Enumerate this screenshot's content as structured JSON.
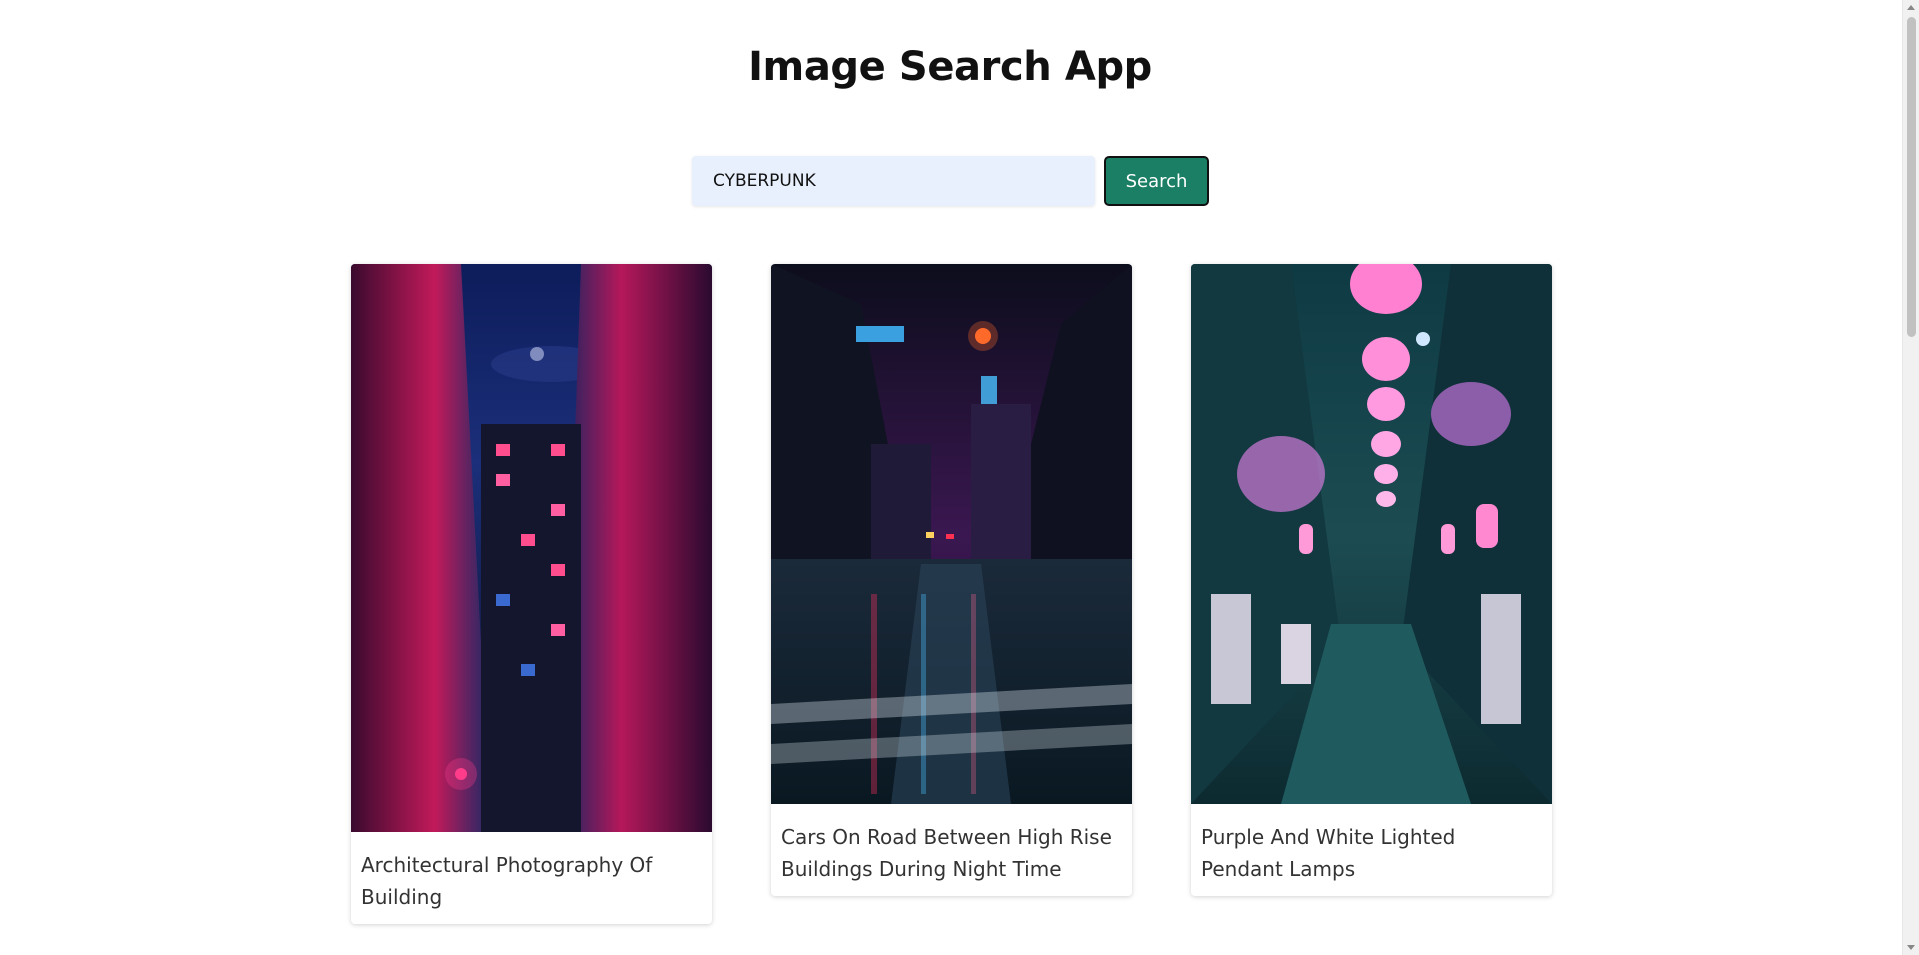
{
  "app": {
    "title": "Image Search App"
  },
  "search": {
    "value": "CYBERPUNK",
    "button_label": "Search"
  },
  "results": [
    {
      "caption": "Architectural Photography Of Building"
    },
    {
      "caption": "Cars On Road Between High Rise Buildings During Night Time"
    },
    {
      "caption": "Purple And White Lighted Pendant Lamps"
    }
  ],
  "colors": {
    "accent": "#1a7f64",
    "input_bg": "#e8f0fe"
  }
}
